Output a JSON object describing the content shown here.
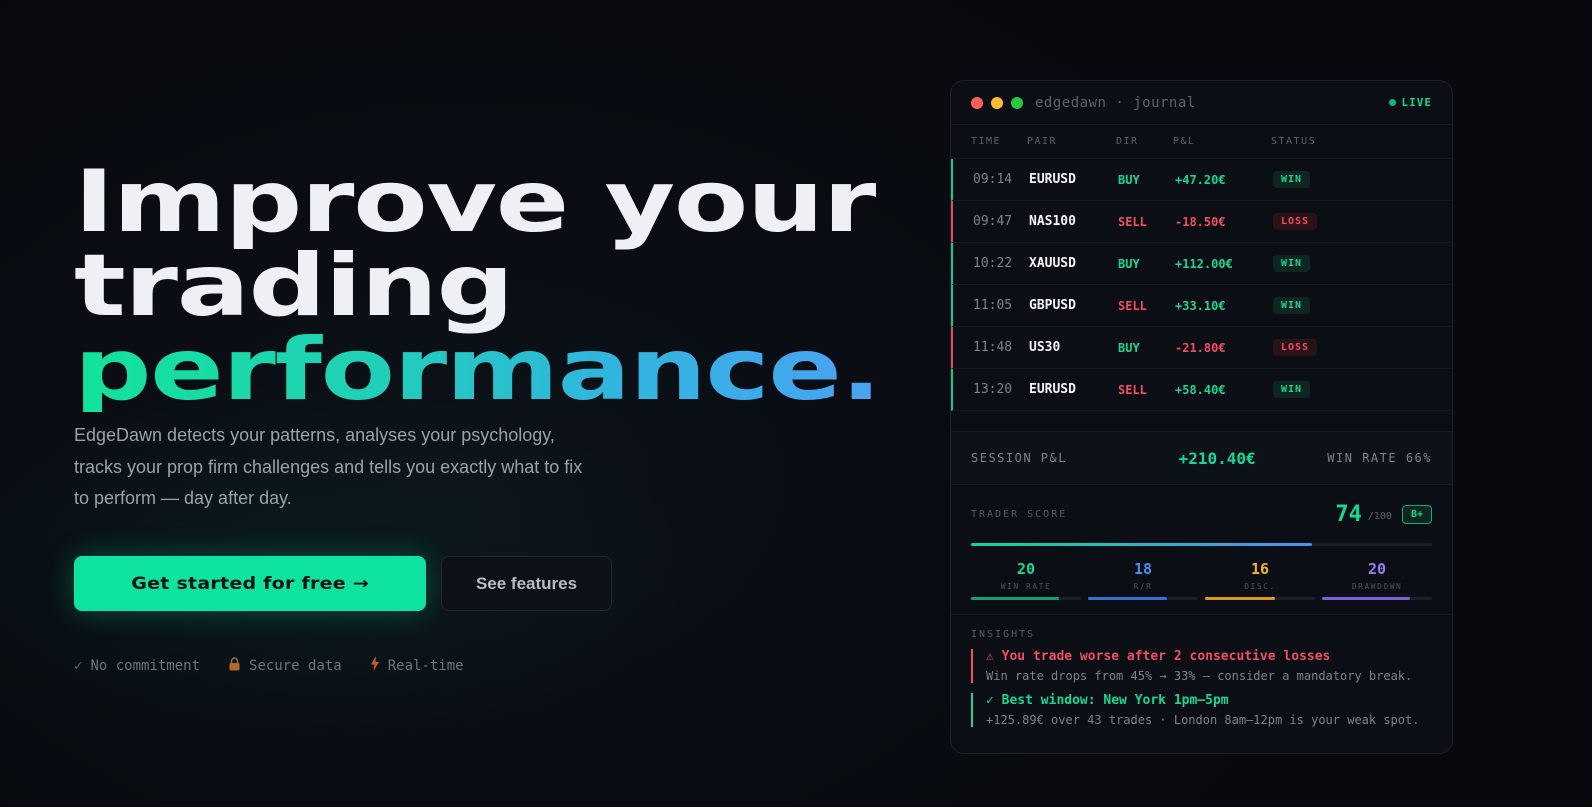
{
  "hero": {
    "headline_line1": "Improve your",
    "headline_line2": "trading",
    "headline_line3": "performance.",
    "description": "EdgeDawn detects your patterns, analyses your psychology, tracks your prop firm challenges and tells you exactly what to fix to perform — day after day.",
    "cta_primary": "Get started for free →",
    "cta_secondary": "See features",
    "badges": [
      {
        "icon": "check-icon",
        "glyph": "✓",
        "label": "No commitment"
      },
      {
        "icon": "lock-icon",
        "glyph": "🔒",
        "label": "Secure data"
      },
      {
        "icon": "bolt-icon",
        "glyph": "ϟ",
        "label": "Real-time"
      }
    ]
  },
  "journal": {
    "window_title": "edgedawn · journal",
    "live_label": "LIVE",
    "columns": {
      "time": "TIME",
      "pair": "PAIR",
      "dir": "DIR",
      "pl": "P&L",
      "status": "STATUS"
    },
    "trades": [
      {
        "time": "09:14",
        "pair": "EURUSD",
        "dir": "BUY",
        "pl": "+47.20€",
        "status": "WIN"
      },
      {
        "time": "09:47",
        "pair": "NAS100",
        "dir": "SELL",
        "pl": "-18.50€",
        "status": "LOSS"
      },
      {
        "time": "10:22",
        "pair": "XAUUSD",
        "dir": "BUY",
        "pl": "+112.00€",
        "status": "WIN"
      },
      {
        "time": "11:05",
        "pair": "GBPUSD",
        "dir": "SELL",
        "pl": "+33.10€",
        "status": "WIN"
      },
      {
        "time": "11:48",
        "pair": "US30",
        "dir": "BUY",
        "pl": "-21.80€",
        "status": "LOSS"
      },
      {
        "time": "13:20",
        "pair": "EURUSD",
        "dir": "SELL",
        "pl": "+58.40€",
        "status": "WIN"
      }
    ],
    "session": {
      "label": "SESSION P&L",
      "value": "+210.40€",
      "win_rate": "WIN RATE 66%"
    },
    "score": {
      "label": "TRADER SCORE",
      "value": "74",
      "max": "/100",
      "grade": "B+",
      "fill_fraction": 0.74,
      "subscores": [
        {
          "value": "20",
          "label": "WIN RATE",
          "color": "#14d894",
          "bar_color": "#16a070",
          "fill_fraction": 0.8
        },
        {
          "value": "18",
          "label": "R/R",
          "color": "#4d8ef5",
          "bar_color": "#3b6fd0",
          "fill_fraction": 0.72
        },
        {
          "value": "16",
          "label": "DISC.",
          "color": "#f4b423",
          "bar_color": "#d49a1c",
          "fill_fraction": 0.64
        },
        {
          "value": "20",
          "label": "DRAWDOWN",
          "color": "#9a7cf4",
          "bar_color": "#7a5fd6",
          "fill_fraction": 0.8
        }
      ]
    },
    "insights": {
      "label": "INSIGHTS",
      "items": [
        {
          "kind": "bad",
          "title": "⚠ You trade worse after 2 consecutive losses",
          "detail": "Win rate drops from 45% → 33% — consider a mandatory break."
        },
        {
          "kind": "good",
          "title": "✓ Best window: New York 1pm–5pm",
          "detail": "+125.89€ over 43 trades · London 8am–12pm is your weak spot."
        }
      ]
    }
  },
  "colors": {
    "accent": "#0fe3a0",
    "loss": "#f04e63",
    "background": "#090c12"
  }
}
